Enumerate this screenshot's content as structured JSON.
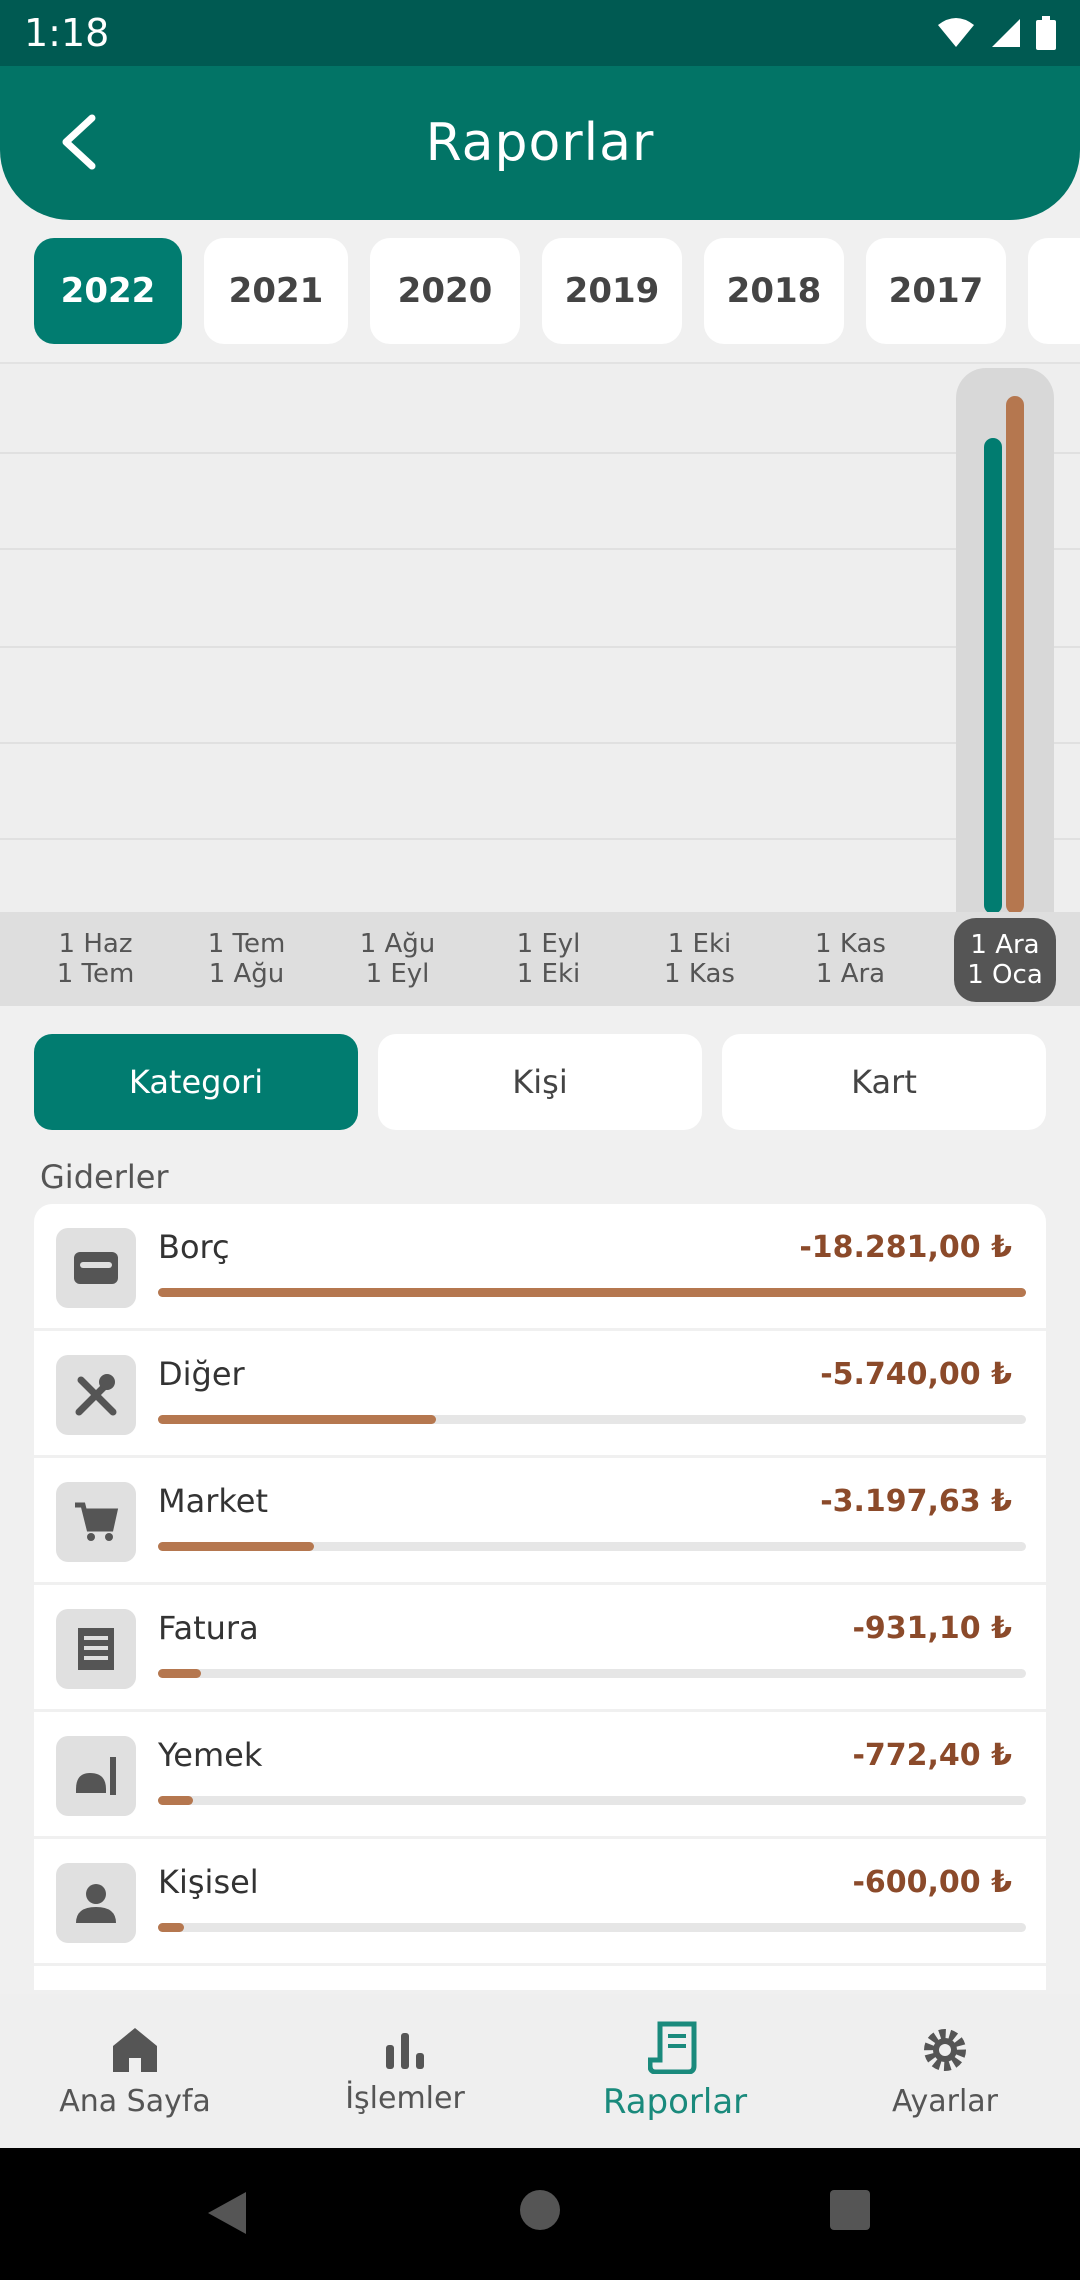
{
  "status_bar": {
    "time": "1:18"
  },
  "header": {
    "title": "Raporlar"
  },
  "years": [
    "2022",
    "2021",
    "2020",
    "2019",
    "2018",
    "2017"
  ],
  "selected_year": "2022",
  "period_labels": [
    {
      "top": "1 Haz",
      "bottom": "1 Tem"
    },
    {
      "top": "1 Tem",
      "bottom": "1 Ağu"
    },
    {
      "top": "1 Ağu",
      "bottom": "1 Eyl"
    },
    {
      "top": "1 Eyl",
      "bottom": "1 Eki"
    },
    {
      "top": "1 Eki",
      "bottom": "1 Kas"
    },
    {
      "top": "1 Kas",
      "bottom": "1 Ara"
    },
    {
      "top": "1 Ara",
      "bottom": "1 Oca"
    }
  ],
  "colors": {
    "primary": "#017c70",
    "expense": "#b5774f",
    "amount_text": "#8b4a2a"
  },
  "tabs": [
    "Kategori",
    "Kişi",
    "Kart"
  ],
  "active_tab": "Kategori",
  "section_title": "Giderler",
  "categories": [
    {
      "name": "Borç",
      "amount": "-18.281,00 ₺",
      "icon": "wallet-icon",
      "share": 1.0
    },
    {
      "name": "Diğer",
      "amount": "-5.740,00 ₺",
      "icon": "tools-icon",
      "share": 0.32
    },
    {
      "name": "Market",
      "amount": "-3.197,63 ₺",
      "icon": "cart-icon",
      "share": 0.18
    },
    {
      "name": "Fatura",
      "amount": "-931,10 ₺",
      "icon": "receipt-icon",
      "share": 0.05
    },
    {
      "name": "Yemek",
      "amount": "-772,40 ₺",
      "icon": "food-icon",
      "share": 0.04
    },
    {
      "name": "Kişisel",
      "amount": "-600,00 ₺",
      "icon": "person-icon",
      "share": 0.03
    }
  ],
  "bottom_nav": [
    {
      "label": "Ana Sayfa",
      "icon": "home-icon"
    },
    {
      "label": "İşlemler",
      "icon": "bar-chart-icon"
    },
    {
      "label": "Raporlar",
      "icon": "report-icon"
    },
    {
      "label": "Ayarlar",
      "icon": "gear-icon"
    }
  ]
}
